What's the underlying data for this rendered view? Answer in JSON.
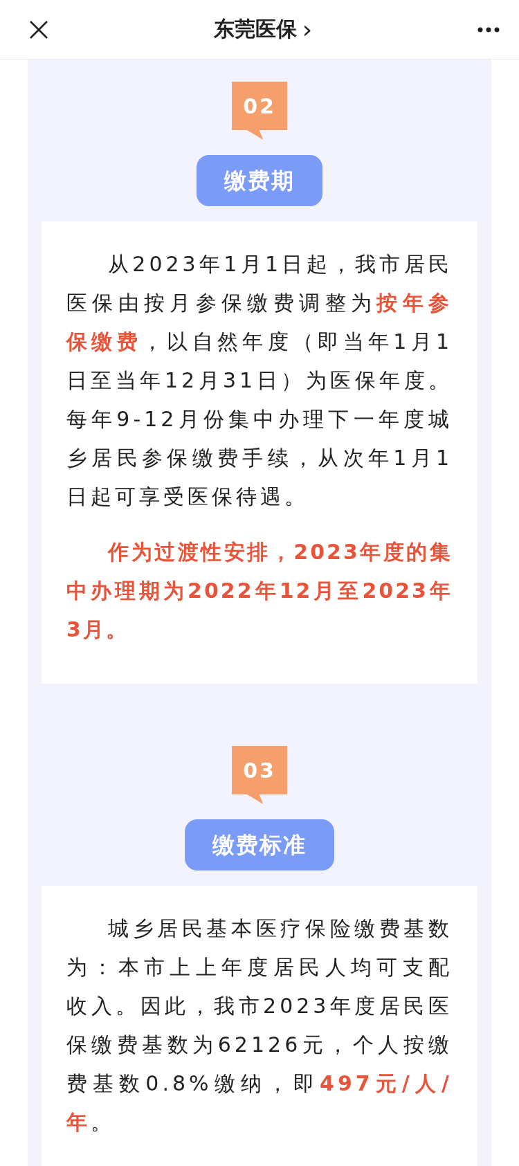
{
  "header": {
    "title": "东莞医保",
    "title_arrow": "›"
  },
  "sections": [
    {
      "number": "02",
      "title": "缴费期",
      "paragraphs": [
        {
          "kind": "normal",
          "text": "从2023年1月1日起，我市居民医保由按月参保缴费调整为**按年参保缴费**，以自然年度（即当年1月1日至当年12月31日）为医保年度。每年9-12月份集中办理下一年度城乡居民参保缴费手续，从次年1月1日起可享受医保待遇。"
        },
        {
          "kind": "emphasis",
          "text": "作为过渡性安排，2023年度的集中办理期为2022年12月至2023年3月。"
        }
      ]
    },
    {
      "number": "03",
      "title": "缴费标准",
      "paragraphs": [
        {
          "kind": "normal",
          "text": "城乡居民基本医疗保险缴费基数为：本市上上年度居民人均可支配收入。因此，我市2023年度居民医保缴费基数为62126元，个人按缴费基数0.8%缴纳，即**497元/人/年**。"
        }
      ]
    }
  ]
}
